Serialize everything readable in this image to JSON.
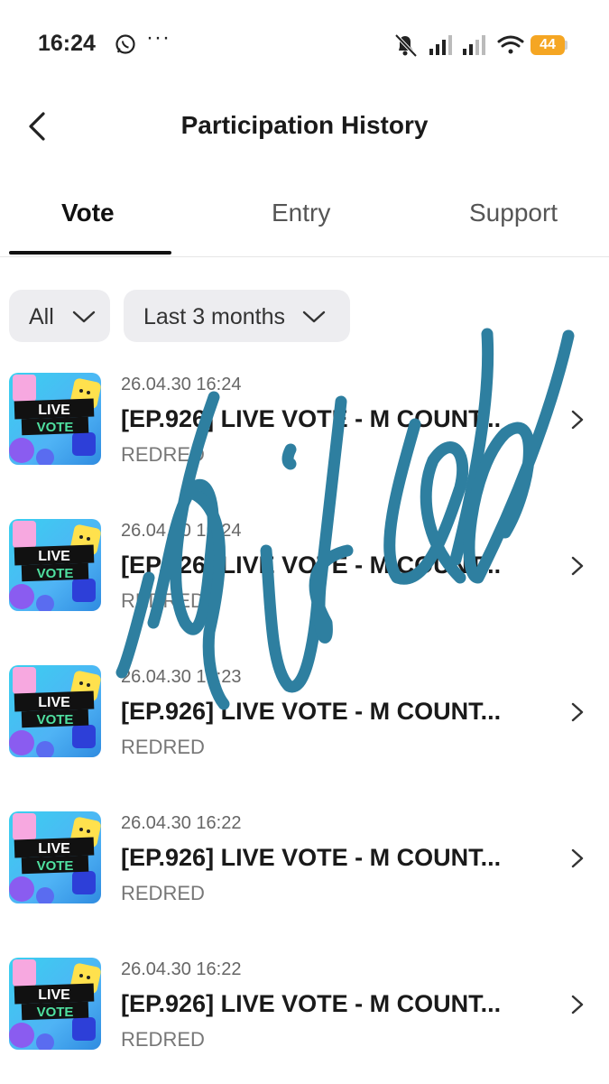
{
  "status_bar": {
    "time": "16:24",
    "dots": "···",
    "battery": "44"
  },
  "header": {
    "title": "Participation History"
  },
  "tabs": [
    {
      "label": "Vote",
      "active": true
    },
    {
      "label": "Entry",
      "active": false
    },
    {
      "label": "Support",
      "active": false
    }
  ],
  "filters": {
    "type": "All",
    "period": "Last 3 months"
  },
  "thumbnail": {
    "line1": "LIVE",
    "line2": "VOTE"
  },
  "items": [
    {
      "date": "26.04.30 16:24",
      "title": "[EP.926] LIVE VOTE - M COUNT...",
      "artist": "REDRED"
    },
    {
      "date": "26.04.30 16:24",
      "title": "[EP.926] LIVE VOTE - M COUNT...",
      "artist": "REDRED"
    },
    {
      "date": "26.04.30 16:23",
      "title": "[EP.926] LIVE VOTE - M COUNT...",
      "artist": "REDRED"
    },
    {
      "date": "26.04.30 16:22",
      "title": "[EP.926] LIVE VOTE - M COUNT...",
      "artist": "REDRED"
    },
    {
      "date": "26.04.30 16:22",
      "title": "[EP.926] LIVE VOTE - M COUNT...",
      "artist": "REDRED"
    }
  ],
  "colors": {
    "accent": "#111111",
    "filter_bg": "#ededf0",
    "signature": "#2e7fa0",
    "battery": "#f5a623"
  }
}
